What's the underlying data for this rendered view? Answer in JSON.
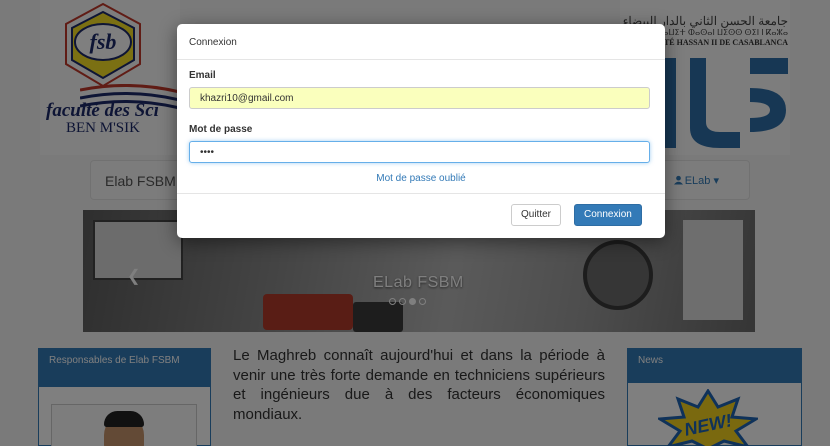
{
  "page": {
    "faculty_logo": {
      "line1": "faculté des Sci",
      "line2": "BEN M'SIK",
      "initials": "fsb"
    },
    "university": {
      "arabic": "جامعة الحسن الثاني بالدار البيضاء",
      "tifinagh": "ⵜⴰⵙⴷⴰⵡⵉⵜ ⵀⴰⵙⴰⵏ ⵡⵉⵙⵙ ⵙⵉⵏ ⵏ ⴽⴰⵣⴰ",
      "french": "RSITÉ HASSAN II DE CASABLANCA"
    },
    "navbar": {
      "brand": "Elab FSBM",
      "user": "ELab"
    },
    "carousel": {
      "caption": "ELab FSBM",
      "slide_count": 4,
      "active_slide": 3
    },
    "left_panel": {
      "title": "Responsables de Elab FSBM"
    },
    "intro_text": "Le Maghreb connaît aujourd'hui et dans la période à venir une très forte demande en techniciens supérieurs et ingénieurs due à des facteurs économiques mondiaux.",
    "right_panel": {
      "title": "News",
      "badge": "NEW!"
    }
  },
  "modal": {
    "title": "Connexion",
    "email_label": "Email",
    "email_value": "khazri10@gmail.com",
    "password_label": "Mot de passe",
    "password_value": "1234",
    "forgot_link": "Mot de passe oublié",
    "quit_button": "Quitter",
    "login_button": "Connexion"
  },
  "colors": {
    "primary": "#337ab7",
    "autofill": "#faffbd",
    "focus": "#66afe9"
  }
}
